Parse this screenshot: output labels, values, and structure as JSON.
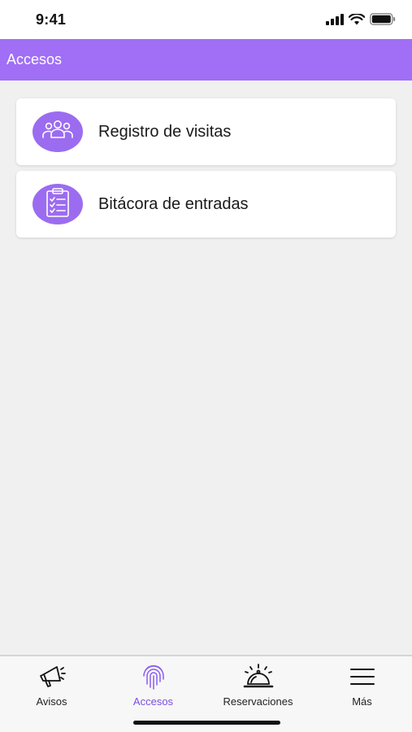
{
  "status_bar": {
    "time": "9:41"
  },
  "header": {
    "title": "Accesos"
  },
  "menu": {
    "items": [
      {
        "label": "Registro de visitas",
        "icon": "people-group-icon"
      },
      {
        "label": "Bitácora de entradas",
        "icon": "clipboard-checklist-icon"
      }
    ]
  },
  "tabs": [
    {
      "label": "Avisos",
      "icon": "megaphone-icon",
      "active": false
    },
    {
      "label": "Accesos",
      "icon": "fingerprint-icon",
      "active": true
    },
    {
      "label": "Reservaciones",
      "icon": "service-bell-icon",
      "active": false
    },
    {
      "label": "Más",
      "icon": "hamburger-menu-icon",
      "active": false
    }
  ],
  "colors": {
    "accent": "#a06ff5",
    "icon_circle": "#9b6cf0",
    "active_tab": "#7a4fe0"
  }
}
